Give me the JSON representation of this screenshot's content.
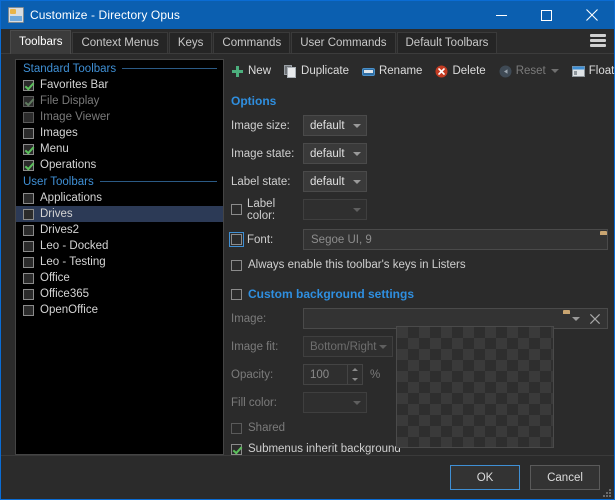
{
  "window": {
    "title": "Customize - Directory Opus",
    "icon": "customize-icon",
    "controls": {
      "minimize": "minimize-icon",
      "maximize": "maximize-icon",
      "close": "close-icon"
    }
  },
  "tabs": [
    {
      "label": "Toolbars",
      "active": true
    },
    {
      "label": "Context Menus",
      "active": false
    },
    {
      "label": "Keys",
      "active": false
    },
    {
      "label": "Commands",
      "active": false
    },
    {
      "label": "User Commands",
      "active": false
    },
    {
      "label": "Default Toolbars",
      "active": false
    }
  ],
  "menu_button": "hamburger-menu-icon",
  "toolbar_list": {
    "groups": [
      {
        "title": "Standard Toolbars",
        "items": [
          {
            "label": "Favorites Bar",
            "checked": true,
            "disabled": false,
            "selected": false
          },
          {
            "label": "File Display",
            "checked": true,
            "disabled": true,
            "selected": false
          },
          {
            "label": "Image Viewer",
            "checked": false,
            "disabled": true,
            "selected": false
          },
          {
            "label": "Images",
            "checked": false,
            "disabled": false,
            "selected": false
          },
          {
            "label": "Menu",
            "checked": true,
            "disabled": false,
            "selected": false
          },
          {
            "label": "Operations",
            "checked": true,
            "disabled": false,
            "selected": false
          }
        ]
      },
      {
        "title": "User Toolbars",
        "items": [
          {
            "label": "Applications",
            "checked": false,
            "disabled": false,
            "selected": false
          },
          {
            "label": "Drives",
            "checked": false,
            "disabled": false,
            "selected": true
          },
          {
            "label": "Drives2",
            "checked": false,
            "disabled": false,
            "selected": false
          },
          {
            "label": "Leo - Docked",
            "checked": false,
            "disabled": false,
            "selected": false
          },
          {
            "label": "Leo - Testing",
            "checked": false,
            "disabled": false,
            "selected": false
          },
          {
            "label": "Office",
            "checked": false,
            "disabled": false,
            "selected": false
          },
          {
            "label": "Office365",
            "checked": false,
            "disabled": false,
            "selected": false
          },
          {
            "label": "OpenOffice",
            "checked": false,
            "disabled": false,
            "selected": false
          }
        ]
      }
    ]
  },
  "commands": [
    {
      "label": "New",
      "icon": "plus-icon",
      "disabled": false,
      "dropdown": false
    },
    {
      "label": "Duplicate",
      "icon": "copy-icon",
      "disabled": false,
      "dropdown": false
    },
    {
      "label": "Rename",
      "icon": "rename-icon",
      "disabled": false,
      "dropdown": false
    },
    {
      "label": "Delete",
      "icon": "delete-icon",
      "disabled": false,
      "dropdown": false
    },
    {
      "label": "Reset",
      "icon": "reset-icon",
      "disabled": true,
      "dropdown": true
    },
    {
      "label": "Float",
      "icon": "float-icon",
      "disabled": false,
      "dropdown": false
    }
  ],
  "options": {
    "section_title": "Options",
    "image_size": {
      "label": "Image size:",
      "value": "default"
    },
    "image_state": {
      "label": "Image state:",
      "value": "default"
    },
    "label_state": {
      "label": "Label state:",
      "value": "default"
    },
    "label_color": {
      "label": "Label color:",
      "checked": false,
      "value": ""
    },
    "font": {
      "label": "Font:",
      "checked": false,
      "value": "Segoe UI, 9",
      "browse_icon": "folder-icon"
    },
    "always_enable": {
      "label": "Always enable this toolbar's keys in Listers",
      "checked": false
    }
  },
  "background": {
    "section_title": "Custom background settings",
    "section_checked": false,
    "image": {
      "label": "Image:",
      "value": "",
      "browse_icon": "folder-icon",
      "dropdown_icon": "chevron-down-icon",
      "clear_icon": "close-icon"
    },
    "image_fit": {
      "label": "Image fit:",
      "value": "Bottom/Right"
    },
    "opacity": {
      "label": "Opacity:",
      "value": "100",
      "unit": "%"
    },
    "fill_color": {
      "label": "Fill color:",
      "value": ""
    },
    "shared": {
      "label": "Shared",
      "checked": false
    },
    "submenus": {
      "label": "Submenus inherit background",
      "checked": true
    },
    "preview": "transparency-checkerboard-preview"
  },
  "footer": {
    "ok": "OK",
    "cancel": "Cancel"
  },
  "colors": {
    "titlebar": "#0b5fb0",
    "accent": "#2f8fe0",
    "group_header": "#3f8fd4",
    "selection": "#2c3a56",
    "check": "#5cc05c",
    "delete_icon": "#c23b22",
    "new_icon": "#4caf7d"
  }
}
